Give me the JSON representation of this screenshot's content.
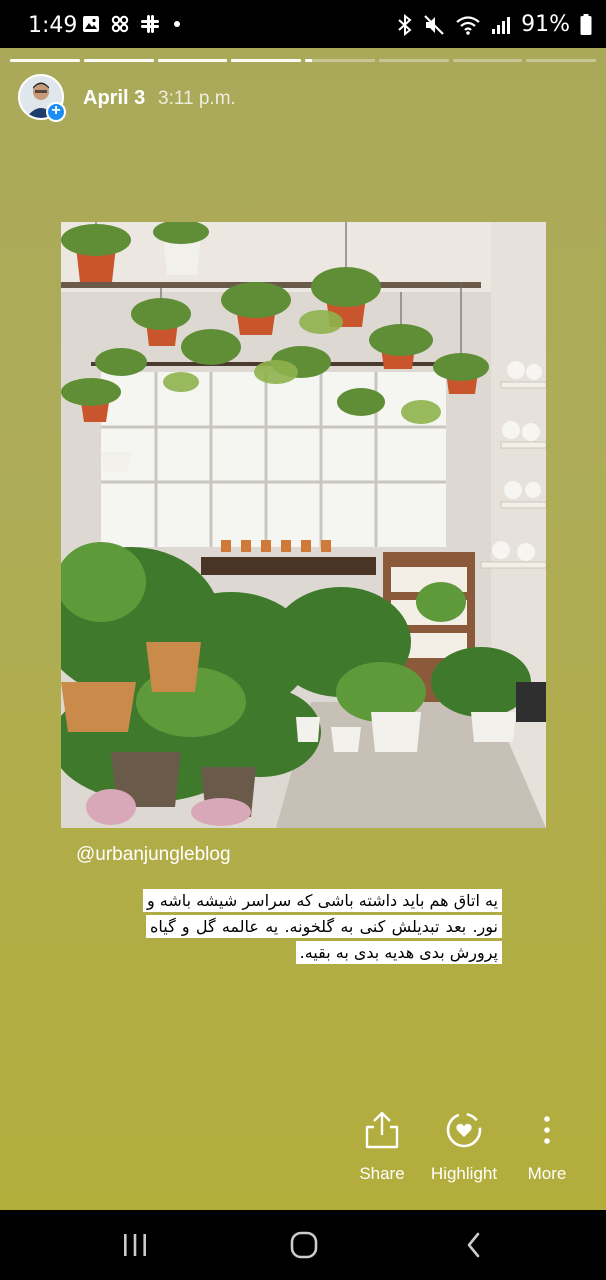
{
  "status_bar": {
    "time": "1:49",
    "battery_percent": "91%",
    "left_icons": [
      "gallery-icon",
      "pinwheel-icon",
      "slack-icon",
      "dot-icon"
    ],
    "right_icons": [
      "bluetooth-icon",
      "mute-icon",
      "wifi-icon",
      "signal-icon",
      "battery-icon"
    ]
  },
  "story": {
    "progress_segments_total": 8,
    "progress_segments_done": 4,
    "current_segment_fraction": 0.1,
    "background_color": "#aead57",
    "header": {
      "date": "April 3",
      "time": "3:11 p.m."
    },
    "photo": {
      "credit": "@urbanjungleblog"
    },
    "caption": "یه اتاق هم باید داشته باشی که سراسر شیشه باشه و نور. بعد تبدیلش کنی به گلخونه. یه عالمه گل و گیاه پرورش بدی هدیه بدی به بقیه."
  },
  "actions": {
    "share_label": "Share",
    "highlight_label": "Highlight",
    "more_label": "More"
  },
  "nav_bar": {
    "icons": [
      "recent-apps-icon",
      "home-icon",
      "back-icon"
    ]
  }
}
